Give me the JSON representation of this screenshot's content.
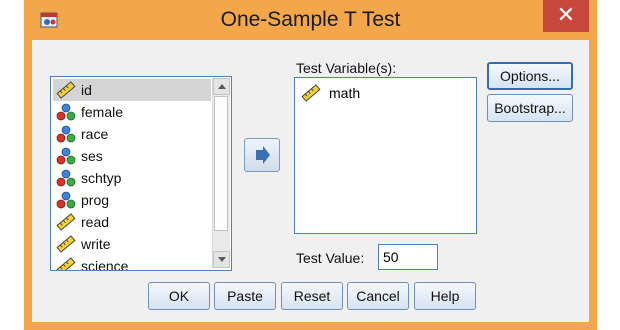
{
  "window": {
    "title": "One-Sample T Test",
    "close_glyph": "✕",
    "app_icon": "spss-dialog-icon"
  },
  "variables": [
    {
      "name": "id",
      "type": "scale",
      "selected": true
    },
    {
      "name": "female",
      "type": "nominal"
    },
    {
      "name": "race",
      "type": "nominal"
    },
    {
      "name": "ses",
      "type": "nominal"
    },
    {
      "name": "schtyp",
      "type": "nominal"
    },
    {
      "name": "prog",
      "type": "nominal"
    },
    {
      "name": "read",
      "type": "scale"
    },
    {
      "name": "write",
      "type": "scale"
    },
    {
      "name": "science",
      "type": "scale"
    }
  ],
  "move_button": {
    "icon": "arrow-right-icon"
  },
  "test_variables": {
    "label": "Test Variable(s):",
    "items": [
      {
        "name": "math",
        "type": "scale"
      }
    ]
  },
  "test_value": {
    "label": "Test Value:",
    "value": "50"
  },
  "side_buttons": {
    "options": "Options...",
    "bootstrap": "Bootstrap..."
  },
  "bottom_buttons": {
    "ok": "OK",
    "paste": "Paste",
    "reset": "Reset",
    "cancel": "Cancel",
    "help": "Help"
  },
  "colors": {
    "frame": "#f3a74a",
    "close": "#c7483a",
    "accent": "#4f7fb8"
  }
}
